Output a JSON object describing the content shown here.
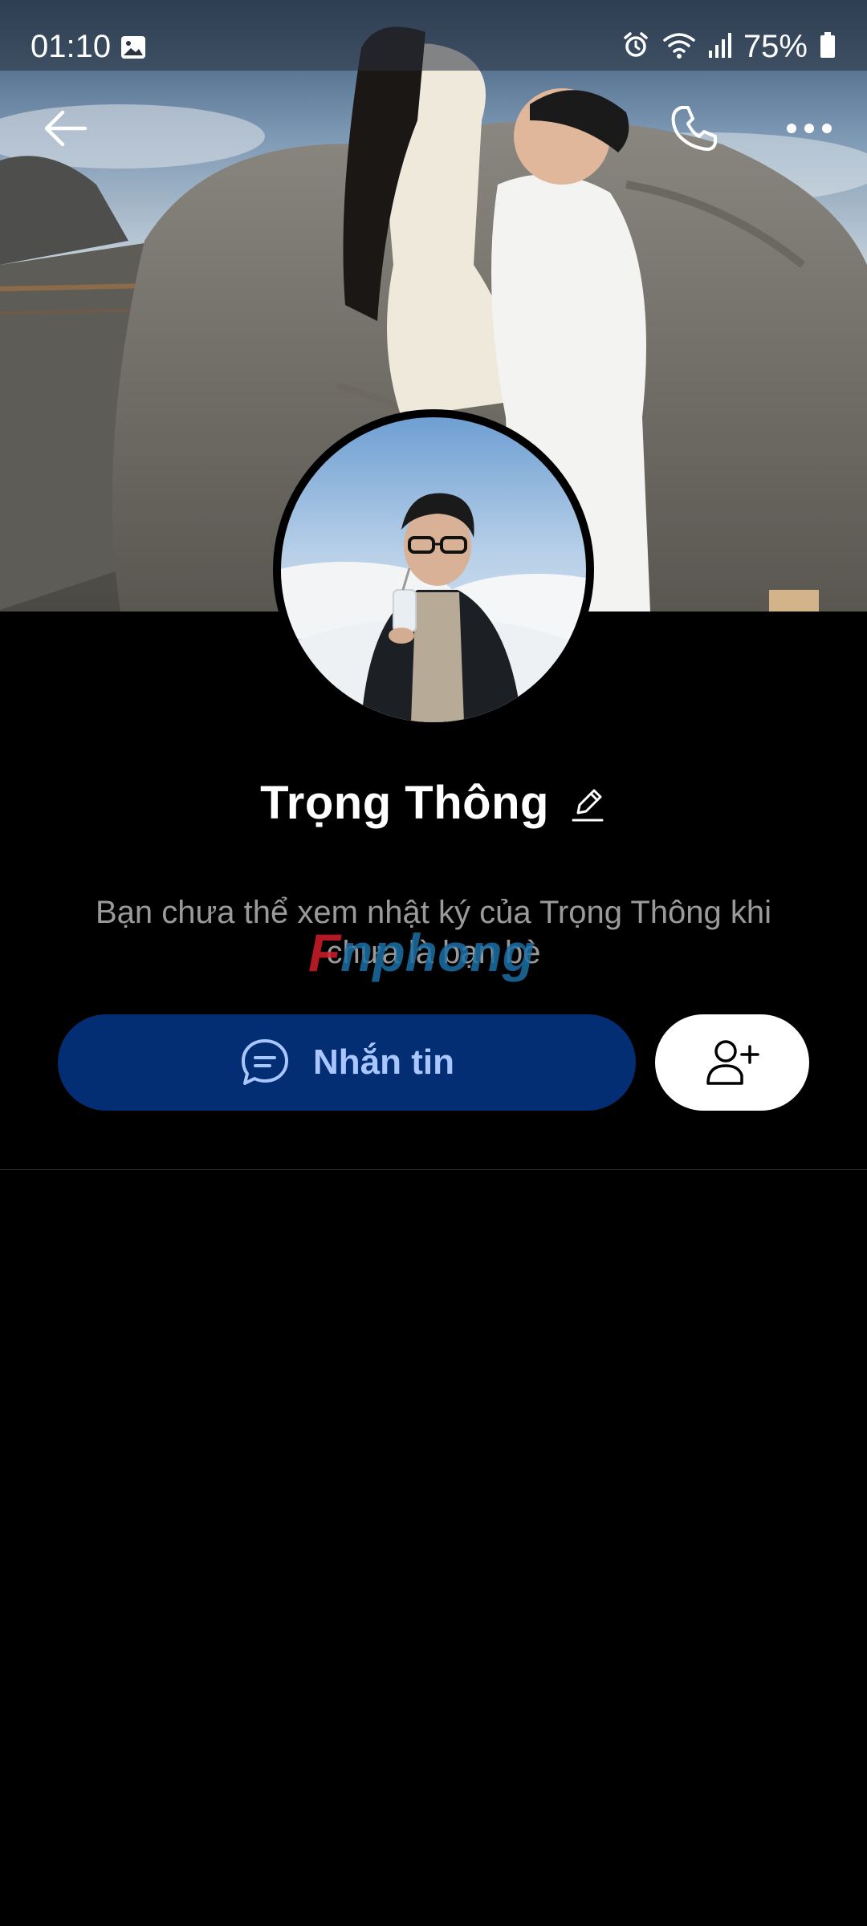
{
  "status_bar": {
    "time": "01:10",
    "battery": "75%",
    "icons": [
      "gallery-icon",
      "alarm-icon",
      "wifi-icon",
      "signal-icon",
      "battery-icon"
    ]
  },
  "top_bar": {
    "icons": [
      "back-arrow-icon",
      "phone-icon",
      "more-icon"
    ]
  },
  "profile": {
    "name": "Trọng Thông",
    "notice": "Bạn chưa thể xem nhật ký của Trọng Thông khi chưa là bạn bè"
  },
  "actions": {
    "message_label": "Nhắn tin",
    "message_icon": "chat-bubble-icon",
    "add_friend_icon": "add-friend-icon"
  },
  "watermark": {
    "text": "Fnphong"
  },
  "colors": {
    "background": "#000000",
    "message_button_bg": "#032e73",
    "message_button_text": "#a9c6ff",
    "notice_text": "#9a9a9a",
    "add_friend_bg": "#ffffff"
  }
}
